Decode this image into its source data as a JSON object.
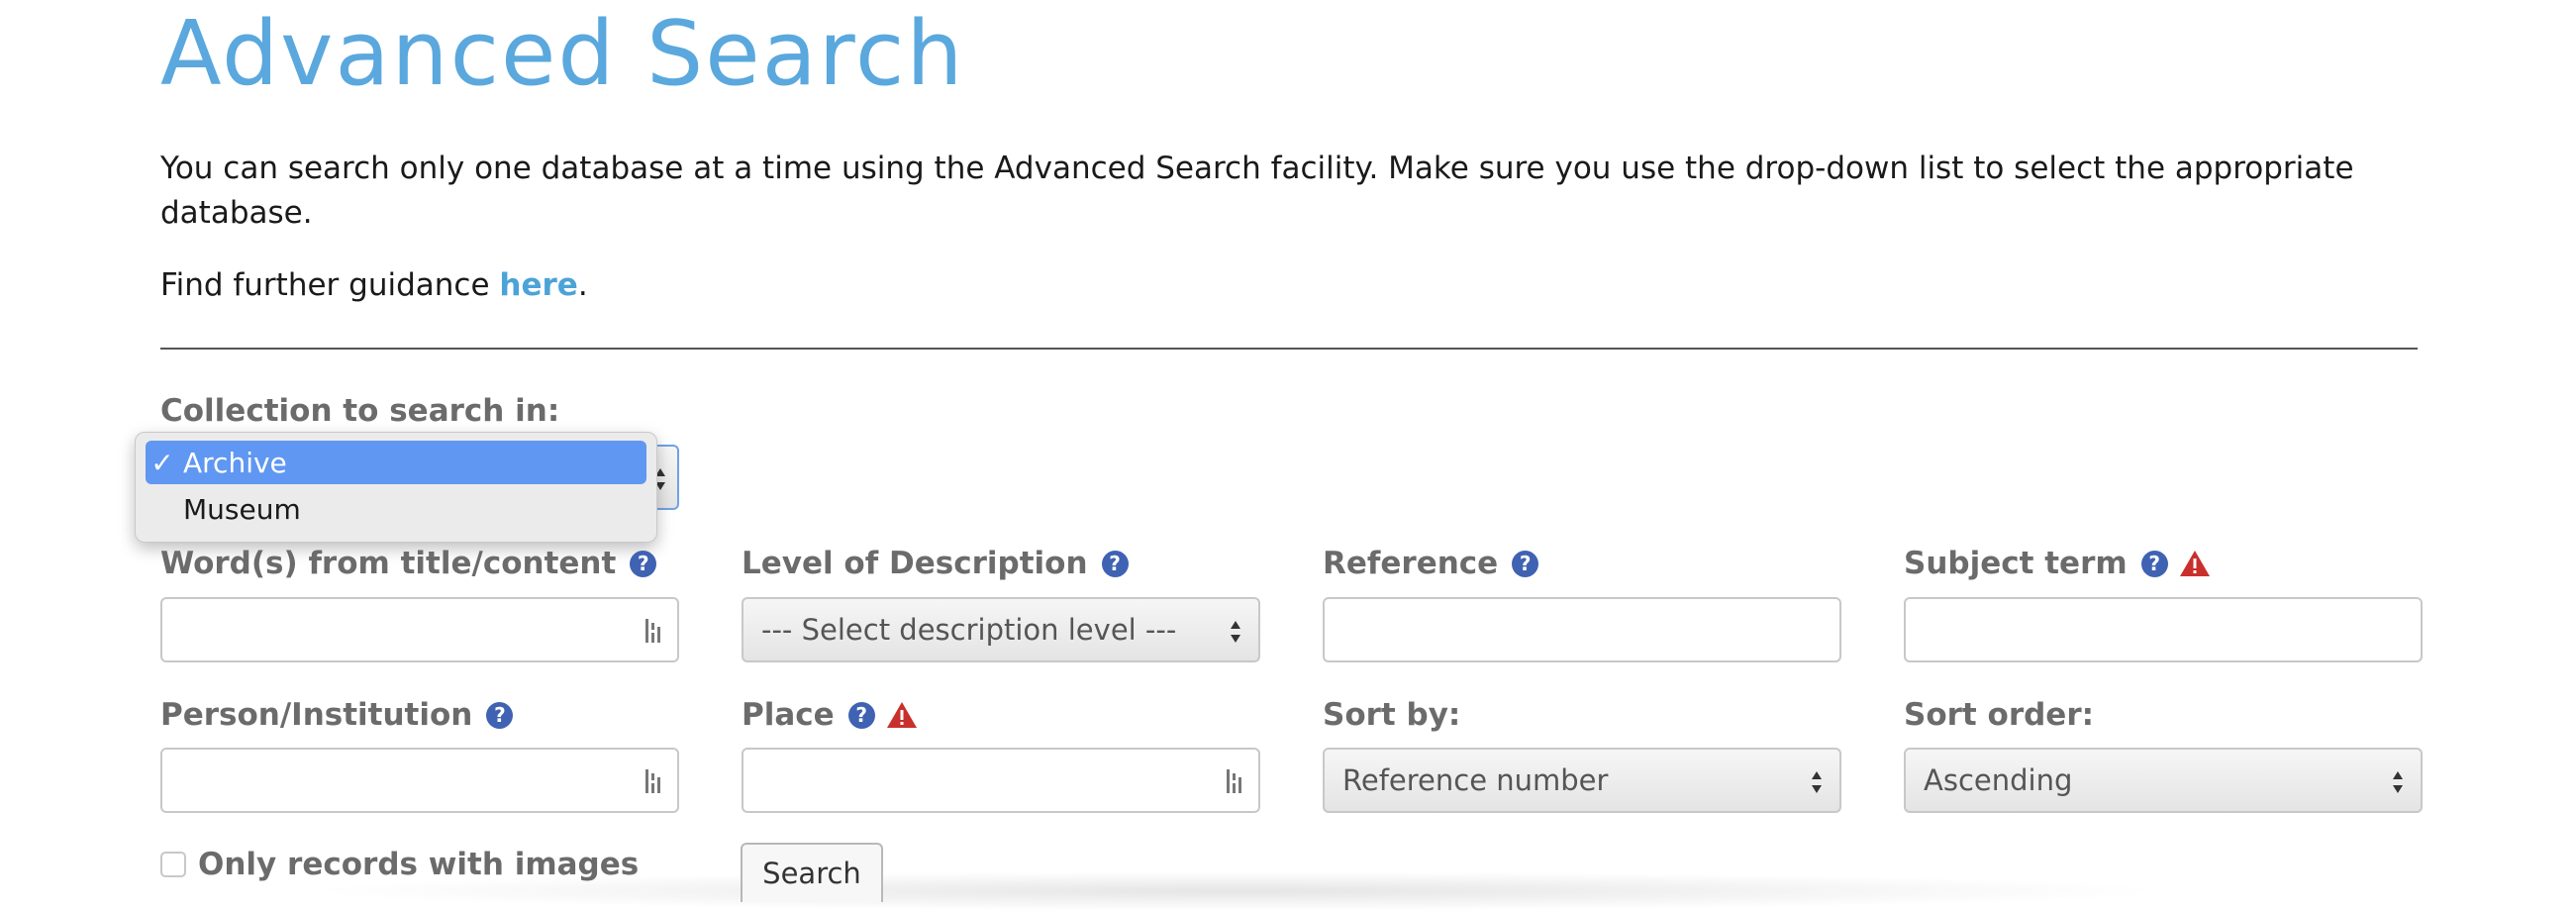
{
  "page": {
    "title": "Advanced Search",
    "intro": "You can search only one database at a time using the Advanced Search facility.  Make sure you use the drop-down list to select the appropriate database.",
    "guidance_prefix": "Find further guidance ",
    "guidance_link": "here",
    "guidance_suffix": "."
  },
  "collection": {
    "label": "Collection to search in:",
    "options": [
      "Archive",
      "Museum"
    ],
    "selected": "Archive",
    "check_glyph": "✓"
  },
  "fields": {
    "words_label": "Word(s) from title/content",
    "level_label": "Level of Description",
    "level_value": "--- Select description level ---",
    "reference_label": "Reference",
    "subject_label": "Subject term",
    "person_label": "Person/Institution",
    "place_label": "Place",
    "sortby_label": "Sort by:",
    "sortby_value": "Reference number",
    "sortorder_label": "Sort order:",
    "sortorder_value": "Ascending",
    "images_label": "Only records with images",
    "help_glyph": "?"
  },
  "search": {
    "label": "Search"
  },
  "icons": {
    "help": "help-question-icon",
    "warning": "warning-triangle-icon",
    "keyboard": "keyboard-icon"
  },
  "colors": {
    "title": "#5aa8dd",
    "link": "#4ba3d8",
    "help_icon": "#3f62b3",
    "warning_icon": "#c9302c",
    "selected_option": "#5f97f2"
  }
}
